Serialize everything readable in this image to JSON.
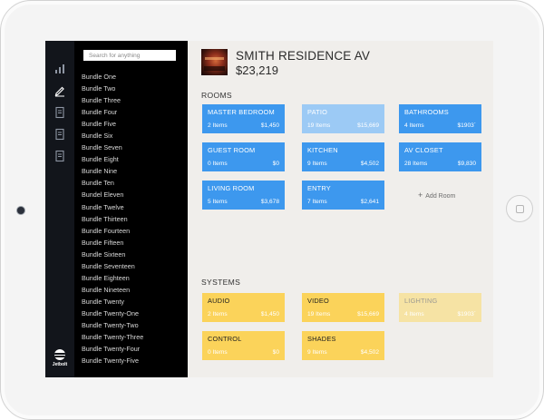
{
  "search": {
    "placeholder": "Search for anything"
  },
  "bundles": [
    "Bundle One",
    "Bundle Two",
    "Bundle Three",
    "Bundle Four",
    "Bundle Five",
    "Bundle Six",
    "Bundle Seven",
    "Bundle Eight",
    "Bundle Nine",
    "Bundle Ten",
    "Bundel Eleven",
    "Bundle Twelve",
    "Bundle Thirteen",
    "Bundle Fourteen",
    "Bundle Fifteen",
    "Bundle Sixteen",
    "Bundle Seventeen",
    "Bundle Eighteen",
    "Bundle Nineteen",
    "Bundle Twenty",
    "Bundle Twenty-One",
    "Bundle Twenty-Two",
    "Bundle Twenty-Three",
    "Bundle Twenty-Four",
    "Bundle Twenty-Five"
  ],
  "rail": {
    "icons": [
      "bar-chart-icon",
      "pencil-icon",
      "document-icon",
      "document-icon",
      "document-icon"
    ],
    "logo_text": "Jetbolt"
  },
  "project": {
    "name": "SMITH RESIDENCE AV",
    "total": "$23,219"
  },
  "rooms": {
    "label": "ROOMS",
    "tiles": [
      {
        "name": "MASTER BEDROOM",
        "items": "2 Items",
        "price": "$1,450",
        "state": "active"
      },
      {
        "name": "PATIO",
        "items": "19 Items",
        "price": "$15,669",
        "state": "faded"
      },
      {
        "name": "BATHROOMS",
        "items": "4 Items",
        "price": "$1903`",
        "state": "active"
      },
      {
        "name": "GUEST ROOM",
        "items": "0 Items",
        "price": "$0",
        "state": "active"
      },
      {
        "name": "KITCHEN",
        "items": "9 Items",
        "price": "$4,502",
        "state": "active"
      },
      {
        "name": "AV CLOSET",
        "items": "28 Items",
        "price": "$9,830",
        "state": "active"
      },
      {
        "name": "LIVING ROOM",
        "items": "5 Items",
        "price": "$3,678",
        "state": "active"
      },
      {
        "name": "ENTRY",
        "items": "7 Items",
        "price": "$2,641",
        "state": "active"
      }
    ],
    "add_label": "Add Room"
  },
  "systems": {
    "label": "SYSTEMS",
    "tiles": [
      {
        "name": "AUDIO",
        "items": "2 Items",
        "price": "$1,450",
        "state": "active"
      },
      {
        "name": "VIDEO",
        "items": "19 Items",
        "price": "$15,669",
        "state": "active"
      },
      {
        "name": "LIGHTING",
        "items": "4 Items",
        "price": "$1903`",
        "state": "faded"
      },
      {
        "name": "CONTROL",
        "items": "0 Items",
        "price": "$0",
        "state": "active"
      },
      {
        "name": "SHADES",
        "items": "9 Items",
        "price": "$4,502",
        "state": "active"
      }
    ]
  },
  "colors": {
    "room_tile": "#3d98ee",
    "room_tile_faded": "#9ccaf5",
    "system_tile": "#fbd35a",
    "system_tile_faded": "#f6e3a4",
    "sidebar": "#000000",
    "rail": "#12151b",
    "main_bg": "#f0eeeb"
  }
}
